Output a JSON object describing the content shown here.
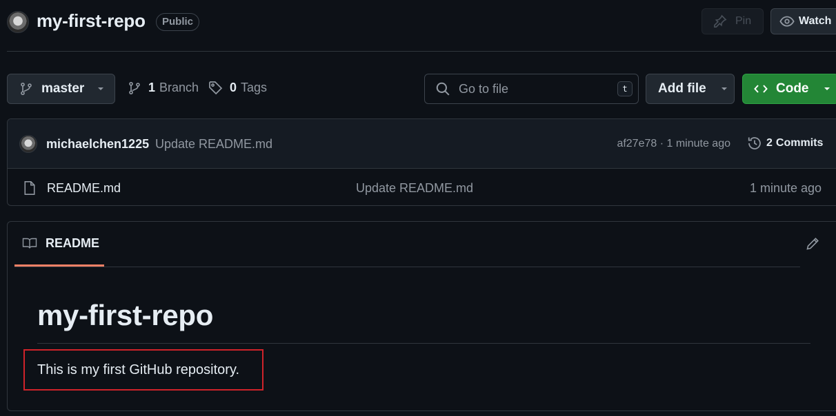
{
  "header": {
    "repo_name": "my-first-repo",
    "visibility": "Public",
    "pin_label": "Pin",
    "watch_label": "Watch"
  },
  "toolbar": {
    "branch": "master",
    "branch_count": "1",
    "branch_label": "Branch",
    "tag_count": "0",
    "tag_label": "Tags",
    "search_placeholder": "Go to file",
    "search_shortcut": "t",
    "add_file_label": "Add file",
    "code_label": "Code"
  },
  "latest_commit": {
    "author": "michaelchen1225",
    "message": "Update README.md",
    "meta": "af27e78 · 1 minute ago",
    "commits_count": "2",
    "commits_label": "Commits"
  },
  "files": [
    {
      "name": "README.md",
      "last_commit": "Update README.md",
      "time": "1 minute ago"
    }
  ],
  "readme": {
    "tab_label": "README",
    "heading": "my-first-repo",
    "paragraph": "This is my first GitHub repository."
  },
  "colors": {
    "background": "#0d1117",
    "code_button": "#238636",
    "readme_tab_underline": "#f78166",
    "annotation_box": "#d0232a"
  }
}
